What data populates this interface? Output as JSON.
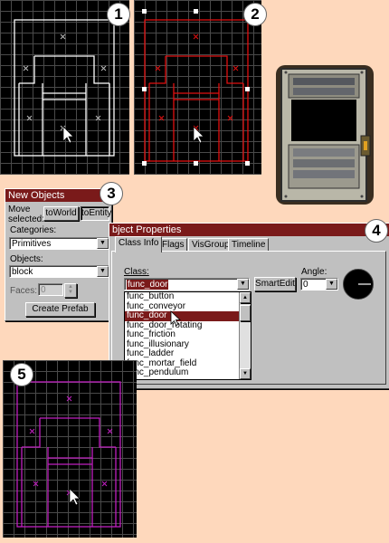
{
  "badges": {
    "b1": "1",
    "b2": "2",
    "b3": "3",
    "b4": "4",
    "b5": "5"
  },
  "colors": {
    "panel1": "#ffffff",
    "panel2": "#e01010",
    "panel5": "#c020c0",
    "titlebar": "#7a1a1a",
    "background": "#fed8bc"
  },
  "new_objects": {
    "title": "New Objects",
    "move_label": "Move selected:",
    "to_world": "toWorld",
    "to_entity": "toEntity",
    "categories_label": "Categories:",
    "categories_value": "Primitives",
    "objects_label": "Objects:",
    "objects_value": "block",
    "faces_label": "Faces:",
    "faces_value": "0",
    "create_prefab": "Create Prefab"
  },
  "object_properties": {
    "title": "bject Properties",
    "tabs": [
      "Class Info",
      "Flags",
      "VisGroup",
      "Timeline"
    ],
    "class_label": "Class:",
    "class_value": "func_door",
    "smartedit": "SmartEdit",
    "angle_label": "Angle:",
    "angle_value": "0",
    "class_options": [
      "func_button",
      "func_conveyor",
      "func_door",
      "func_door_rotating",
      "func_friction",
      "func_illusionary",
      "func_ladder",
      "func_mortar_field",
      "func_pendulum"
    ],
    "selected_option": "func_door"
  },
  "icons": {
    "cursor": "arrow-cursor-icon",
    "center": "x-marker-icon",
    "dropdown": "chevron-down-icon",
    "angle": "angle-dial-icon",
    "preview": "door-texture-preview"
  }
}
